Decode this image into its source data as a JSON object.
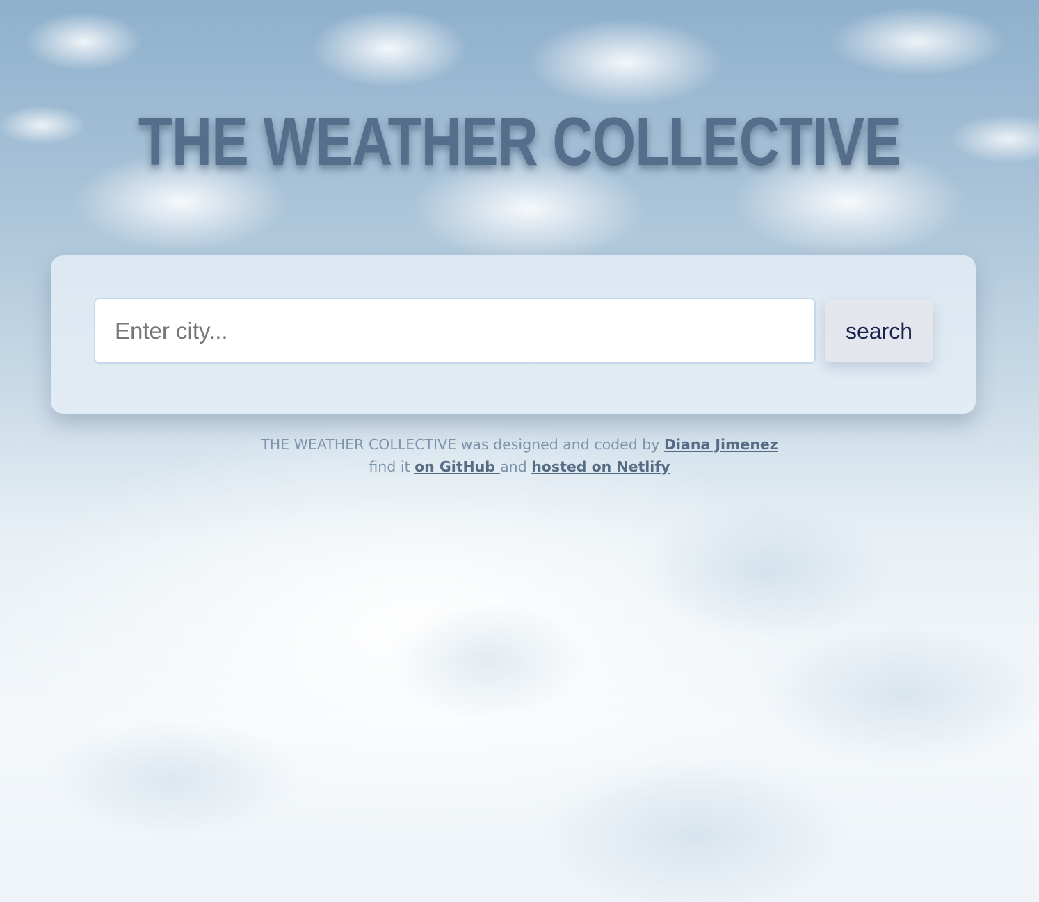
{
  "header": {
    "title": "THE WEATHER COLLECTIVE"
  },
  "search": {
    "placeholder": "Enter city...",
    "value": "",
    "button_label": "search"
  },
  "footer": {
    "line1_prefix": "THE WEATHER COLLECTIVE was designed and coded by ",
    "author_link": "Diana Jimenez",
    "line2_prefix": "find it ",
    "github_link": "on GitHub ",
    "line2_middle": "and ",
    "netlify_link": "hosted on Netlify"
  },
  "colors": {
    "title": "#556e8c",
    "button_text": "#1d2350",
    "footer_text": "#7d93ab",
    "footer_link": "#566c86"
  }
}
